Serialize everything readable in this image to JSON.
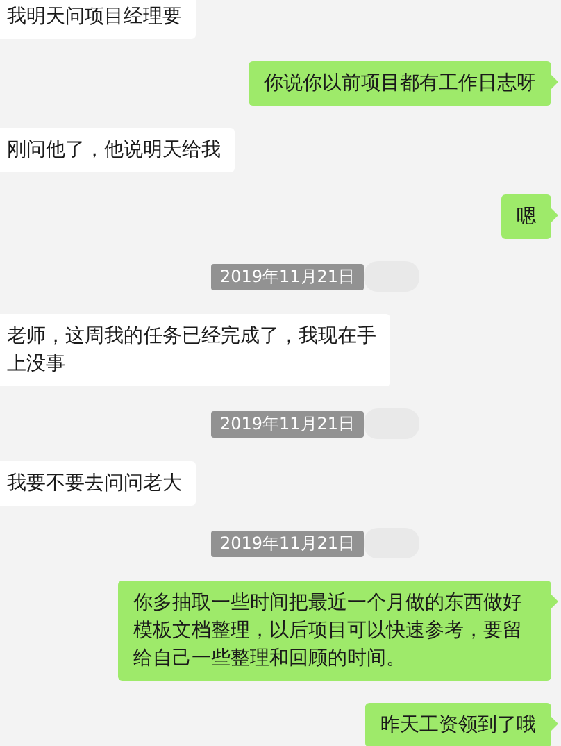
{
  "messages": [
    {
      "kind": "received",
      "text": "我明天问项目经理要"
    },
    {
      "kind": "sent",
      "text": "你说你以前项目都有工作日志呀"
    },
    {
      "kind": "received",
      "text": "刚问他了，他说明天给我"
    },
    {
      "kind": "sent",
      "text": "嗯"
    },
    {
      "kind": "time",
      "text": "2019年11月21日"
    },
    {
      "kind": "received",
      "text": "老师，这周我的任务已经完成了，我现在手上没事"
    },
    {
      "kind": "time",
      "text": "2019年11月21日"
    },
    {
      "kind": "received",
      "text": "我要不要去问问老大"
    },
    {
      "kind": "time",
      "text": "2019年11月21日"
    },
    {
      "kind": "sent",
      "text": "你多抽取一些时间把最近一个月做的东西做好模板文档整理，以后项目可以快速参考，要留给自己一些整理和回顾的时间。"
    },
    {
      "kind": "sent",
      "text": "昨天工资领到了哦"
    }
  ]
}
